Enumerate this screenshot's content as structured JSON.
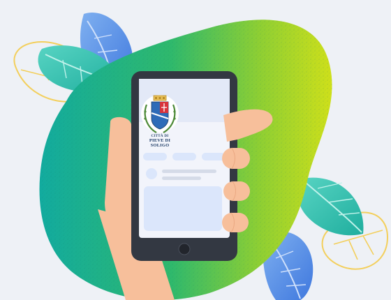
{
  "illustration": {
    "crest": {
      "line1": "CITTÀ DI",
      "line2": "PIEVE DI SOLIGO"
    }
  },
  "colors": {
    "background": "#eef1f6",
    "blob_start": "#17b3a5",
    "blob_mid": "#3ec26a",
    "blob_end": "#c8de1c",
    "phone_body": "#333842",
    "screen": "#f2f4fb",
    "skin": "#f7bf9b",
    "leaf_blue": "#5b8ee6",
    "leaf_teal": "#35c3b5",
    "outline_yellow": "#f3cf5c"
  },
  "icons": [
    "crest-icon",
    "home-button-icon"
  ]
}
